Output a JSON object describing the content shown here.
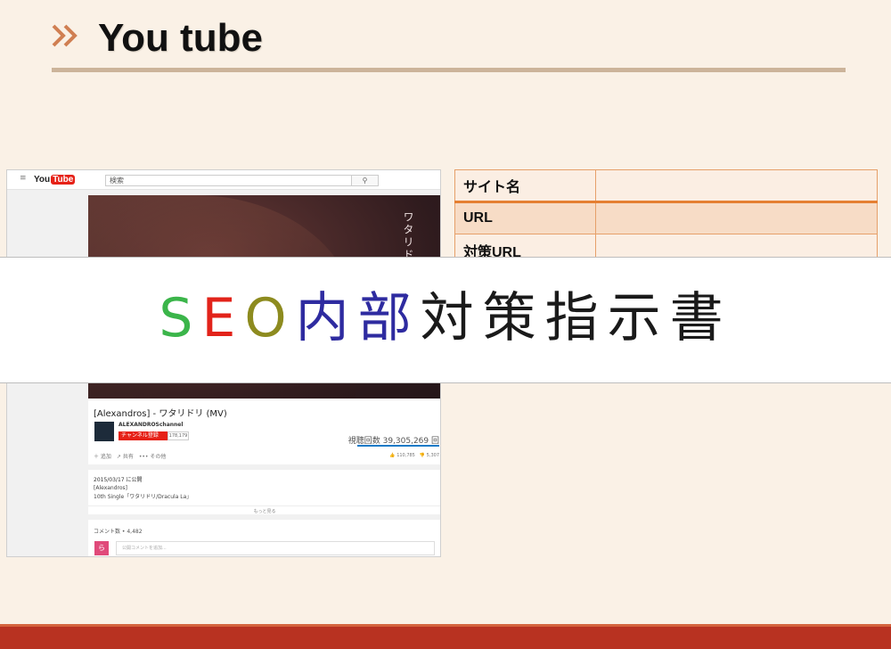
{
  "slide": {
    "title": "You tube"
  },
  "youtube": {
    "logo_you": "You",
    "logo_tube": "Tube",
    "search_placeholder": "検索",
    "video_title_vertical": "ワタリドリ",
    "video_title": "[Alexandros] - ワタリドリ (MV)",
    "channel_name": "ALEXANDROSchannel",
    "subscribe_label": "チャンネル登録",
    "subscriber_count": "178,179",
    "view_count": "視聴回数 39,305,269 回",
    "actions": "＋ 追加　↗ 共有　••• その他",
    "likes": "👍 110,785　👎 5,307",
    "publish_date": "2015/03/17 に公開",
    "desc_line1": "[Alexandros]",
    "desc_line2": "10th Single「ワタリドリ/Dracula La」",
    "show_more": "もっと見る",
    "comment_count": "コメント数 • 4,482",
    "comment_avatar": "ら",
    "comment_placeholder": "公開コメントを追加..."
  },
  "info_table": [
    {
      "label": "サイト名",
      "value": ""
    },
    {
      "label": "URL",
      "value": ""
    },
    {
      "label": "対策URL",
      "value": ""
    }
  ],
  "banner": {
    "part1": "S",
    "part2": "E",
    "part3": "O",
    "part4": "内部",
    "part5": "対策指示書"
  },
  "colors": {
    "background": "#faf1e6",
    "accent_rule": "#ccb49a",
    "table_border": "#e6a06a",
    "footer": "#b83221"
  }
}
